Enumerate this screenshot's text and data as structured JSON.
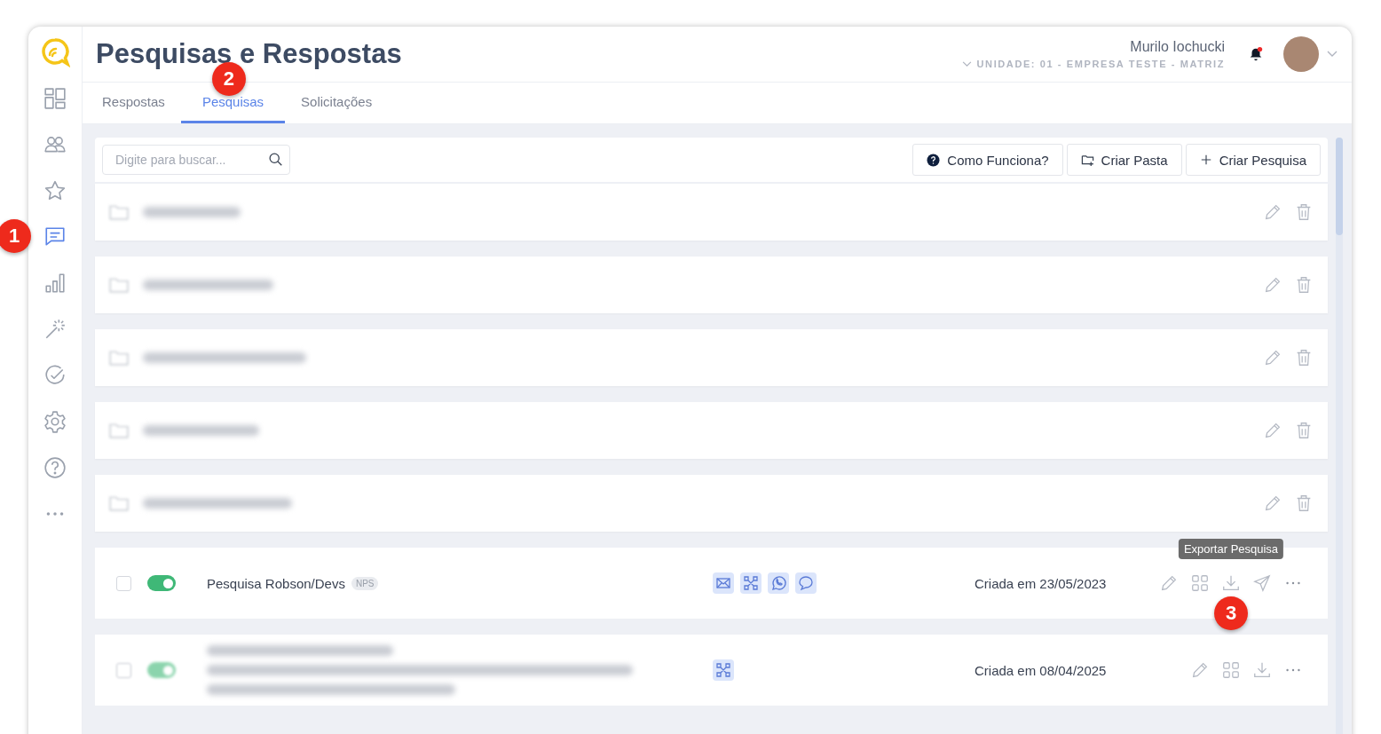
{
  "sidebar": {
    "items": [
      {
        "kind": "dashboard",
        "selected": false
      },
      {
        "kind": "people",
        "selected": false
      },
      {
        "kind": "star",
        "selected": false
      },
      {
        "kind": "chat",
        "selected": true,
        "badge": "1"
      },
      {
        "kind": "chart",
        "selected": false
      },
      {
        "kind": "wand",
        "selected": false
      },
      {
        "kind": "check",
        "selected": false
      },
      {
        "kind": "gear",
        "selected": false
      },
      {
        "kind": "help",
        "selected": false
      },
      {
        "kind": "more",
        "selected": false
      }
    ]
  },
  "header": {
    "title": "Pesquisas e Respostas",
    "user": "Murilo Iochucki",
    "unit": "UNIDADE: 01 - EMPRESA TESTE - MATRIZ",
    "notification": true
  },
  "tabs": [
    {
      "label": "Respostas",
      "selected": false
    },
    {
      "label": "Pesquisas",
      "selected": true,
      "badge": "2"
    },
    {
      "label": "Solicitações",
      "selected": false
    }
  ],
  "search": {
    "placeholder": "Digite para buscar..."
  },
  "buttons": [
    {
      "kind": "help",
      "label": "Como Funciona?"
    },
    {
      "kind": "folder",
      "label": "Criar Pasta"
    },
    {
      "kind": "plus",
      "label": "Criar Pesquisa"
    }
  ],
  "folders": [
    {
      "redacted": true
    },
    {
      "redacted": true
    },
    {
      "redacted": true
    },
    {
      "redacted": true
    },
    {
      "redacted": true
    }
  ],
  "surveys": [
    {
      "redacted": false,
      "title": "Pesquisa Robson/Devs",
      "tag": "NPS",
      "checked": false,
      "on": true,
      "channels": [
        {
          "kind": "email"
        },
        {
          "kind": "qr"
        },
        {
          "kind": "whatsapp"
        },
        {
          "kind": "chat"
        }
      ],
      "date": "Criada em 23/05/2023",
      "actions": [
        {
          "kind": "edit"
        },
        {
          "kind": "grid"
        },
        {
          "kind": "download",
          "tooltip": "Exportar Pesquisa",
          "badge": "3"
        },
        {
          "kind": "send"
        },
        {
          "kind": "more"
        }
      ]
    },
    {
      "redacted": true,
      "checked": false,
      "on": true,
      "channels": [
        {
          "kind": "qr"
        }
      ],
      "date": "Criada em 08/04/2025",
      "actions": [
        {
          "kind": "edit"
        },
        {
          "kind": "grid"
        },
        {
          "kind": "download"
        },
        {
          "kind": "more"
        }
      ]
    }
  ]
}
